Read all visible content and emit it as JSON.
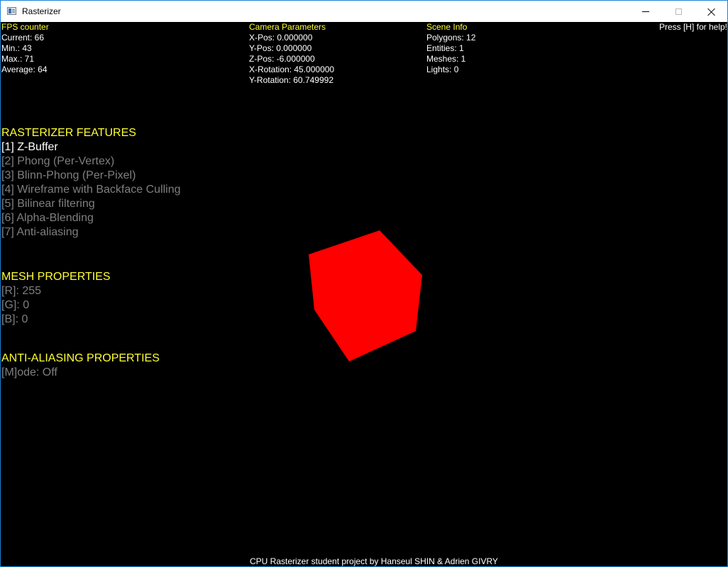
{
  "window": {
    "title": "Rasterizer",
    "icon": "app-window-icon",
    "controls": [
      "minimize-icon",
      "maximize-icon",
      "close-icon"
    ]
  },
  "hud": {
    "fps": {
      "title": "FPS counter",
      "current": "Current: 66",
      "min": "Min.: 43",
      "max": "Max.: 71",
      "average": "Average: 64"
    },
    "camera": {
      "title": "Camera Parameters",
      "x_pos": "X-Pos: 0.000000",
      "y_pos": "Y-Pos: 0.000000",
      "z_pos": "Z-Pos: -6.000000",
      "x_rot": "X-Rotation: 45.000000",
      "y_rot": "Y-Rotation: 60.749992"
    },
    "scene": {
      "title": "Scene Info",
      "polygons": "Polygons: 12",
      "entities": "Entities: 1",
      "meshes": "Meshes: 1",
      "lights": "Lights: 0"
    },
    "help": "Press [H] for help!"
  },
  "features": {
    "title": "RASTERIZER FEATURES",
    "items": [
      {
        "label": "[1] Z-Buffer",
        "enabled": true
      },
      {
        "label": "[2] Phong (Per-Vertex)",
        "enabled": false
      },
      {
        "label": "[3] Blinn-Phong (Per-Pixel)",
        "enabled": false
      },
      {
        "label": "[4] Wireframe with Backface Culling",
        "enabled": false
      },
      {
        "label": "[5] Bilinear filtering",
        "enabled": false
      },
      {
        "label": "[6] Alpha-Blending",
        "enabled": false
      },
      {
        "label": "[7] Anti-aliasing",
        "enabled": false
      }
    ]
  },
  "mesh": {
    "title": "MESH PROPERTIES",
    "r": "[R]: 255",
    "g": "[G]: 0",
    "b": "[B]: 0"
  },
  "aa": {
    "title": "ANTI-ALIASING PROPERTIES",
    "mode": "[M]ode: Off"
  },
  "footer": "CPU Rasterizer student project by Hanseul SHIN & Adrien GIVRY",
  "colors": {
    "heading": "#ffff33",
    "enabled": "#ffffff",
    "disabled": "#7f7f7f",
    "mesh": "#ff0000",
    "background": "#000000"
  }
}
